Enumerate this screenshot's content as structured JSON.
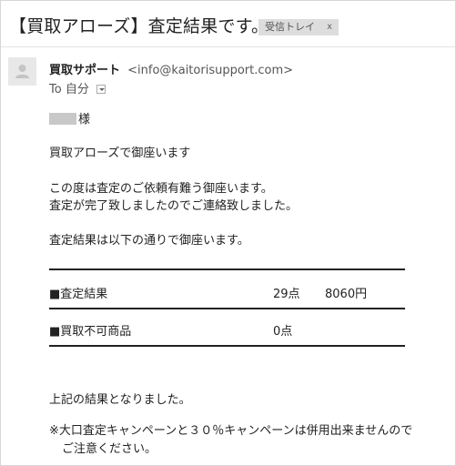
{
  "header": {
    "subject": "【買取アローズ】査定結果です。",
    "label": "受信トレイ",
    "label_close": "x"
  },
  "sender": {
    "name": "買取サポート",
    "email": "<info@kaitorisupport.com>",
    "to_label": "To",
    "to_value": "自分"
  },
  "body": {
    "salutation_suffix": "様",
    "greeting": "買取アローズで御座います",
    "para1_line1": "この度は査定のご依頼有難う御座います。",
    "para1_line2": "査定が完了致しましたのでご連絡致しました。",
    "para2": "査定結果は以下の通りで御座います。",
    "table": [
      {
        "label": "■査定結果",
        "count": "29点",
        "amount": "8060円"
      },
      {
        "label": "■買取不可商品",
        "count": "0点",
        "amount": ""
      }
    ],
    "closing": "上記の結果となりました。",
    "note_line1": "※大口査定キャンペーンと３０％キャンペーンは併用出来ませんので",
    "note_line2": "ご注意ください。"
  },
  "icons": {
    "avatar": "person-icon",
    "dropdown": "chevron-down-icon",
    "redaction": "redacted-name"
  }
}
